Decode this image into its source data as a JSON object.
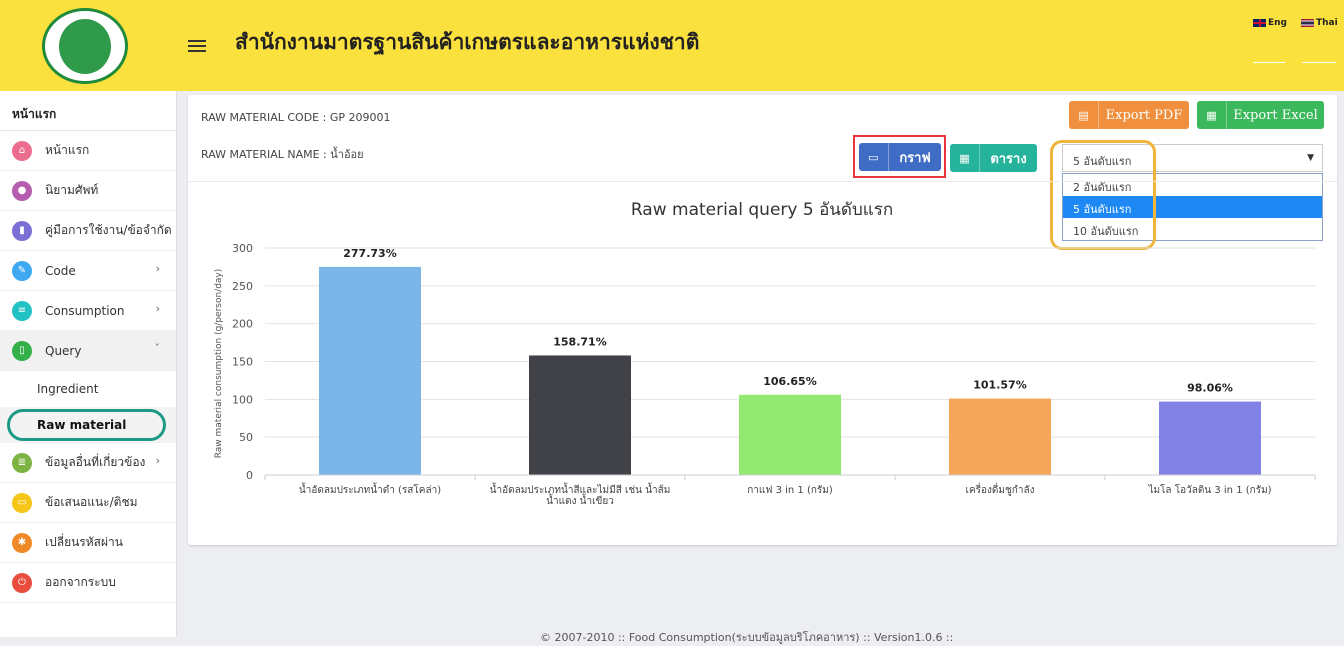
{
  "header": {
    "title": "สำนักงานมาตรฐานสินค้าเกษตรและอาหารแห่งชาติ",
    "lang_eng": "Eng",
    "lang_thai": "Thai"
  },
  "sidebar": {
    "heading": "หน้าแรก",
    "items": [
      {
        "label": "หน้าแรก",
        "color": "#ec6d8d",
        "icon": "home-icon"
      },
      {
        "label": "นิยามศัพท์",
        "color": "#b75db0",
        "icon": "lightbulb-icon"
      },
      {
        "label": "คู่มือการใช้งาน/ข้อจำกัด",
        "color": "#7b6fd6",
        "icon": "book-icon"
      },
      {
        "label": "Code",
        "color": "#3ea8f0",
        "icon": "wrench-icon"
      },
      {
        "label": "Consumption",
        "color": "#22c1c3",
        "icon": "list-icon"
      },
      {
        "label": "Query",
        "color": "#34b04a",
        "icon": "document-icon"
      },
      {
        "label": "ข้อมูลอื่นที่เกี่ยวข้อง",
        "color": "#7cb342",
        "icon": "database-icon"
      },
      {
        "label": "ข้อเสนอแนะ/ติชม",
        "color": "#f5c518",
        "icon": "comment-icon"
      },
      {
        "label": "เปลี่ยนรหัสผ่าน",
        "color": "#f08a28",
        "icon": "gear-icon"
      },
      {
        "label": "ออกจากระบบ",
        "color": "#e84d3d",
        "icon": "power-icon"
      }
    ],
    "query_sub": [
      "Ingredient",
      "Raw material"
    ]
  },
  "main": {
    "code_line": "RAW MATERIAL CODE : GP 209001",
    "name_line": "RAW MATERIAL NAME : น้ำอ้อย",
    "export_pdf": "Export PDF",
    "export_excel": "Export Excel",
    "graph_btn": "กราฟ",
    "table_btn": "ตาราง",
    "select_value": "5 อันดับแรก",
    "options": [
      "2 อันดับแรก",
      "5 อันดับแรก",
      "10 อันดับแรก"
    ],
    "colors": {
      "pdf": "#f0903e",
      "excel": "#3cb85c",
      "graph": "#3f6cc4",
      "table": "#26b39b"
    }
  },
  "chart_data": {
    "type": "bar",
    "title": "Raw material query 5 อันดับแรก",
    "xlabel": "",
    "ylabel": "Raw material consumption (g/person/day)",
    "ylim": [
      0,
      300
    ],
    "yticks": [
      0,
      50,
      100,
      150,
      200,
      250,
      300
    ],
    "grid": true,
    "categories": [
      [
        "น้ำอัดลมประเภทน้ำดำ (รสโคล่า)"
      ],
      [
        "น้ำอัดลมประเภทน้ำสีและไม่มีสี เช่น น้ำส้ม",
        "น้ำแดง น้ำเขียว"
      ],
      [
        "กาแฟ 3 in 1 (กรัม)"
      ],
      [
        "เครื่องดื่มชูกำลัง"
      ],
      [
        "ไมโล โอวัลติน 3 in 1 (กรัม)"
      ]
    ],
    "values": [
      275,
      158,
      106,
      101,
      97
    ],
    "labels": [
      "277.73%",
      "158.71%",
      "106.65%",
      "101.57%",
      "98.06%"
    ],
    "colors": [
      "#7bb5ea",
      "#414148",
      "#93e872",
      "#f5a65b",
      "#8282e6"
    ]
  },
  "footer": "© 2007-2010 :: Food Consumption(ระบบข้อมูลบริโภคอาหาร) :: Version1.0.6 ::"
}
